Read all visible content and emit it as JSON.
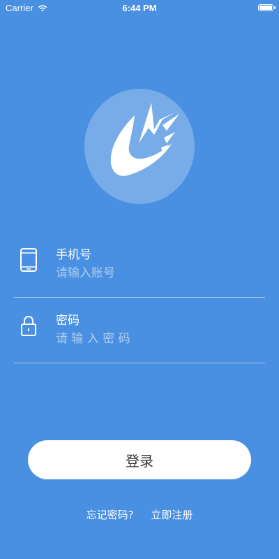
{
  "status_bar": {
    "carrier": "Carrier",
    "time": "6:44 PM",
    "battery_level": 1.0
  },
  "logo": {
    "icon": "bird-logo-icon"
  },
  "form": {
    "phone": {
      "label": "手机号",
      "placeholder": "请输入账号",
      "value": "",
      "icon": "phone-icon"
    },
    "password": {
      "label": "密码",
      "placeholder": "请 输 入 密 码",
      "value": "",
      "icon": "lock-icon"
    }
  },
  "actions": {
    "login_label": "登录",
    "forgot_label": "忘记密码?",
    "register_label": "立即注册"
  },
  "colors": {
    "background": "#4a90e2",
    "button_bg": "#ffffff",
    "button_text": "#333333"
  }
}
